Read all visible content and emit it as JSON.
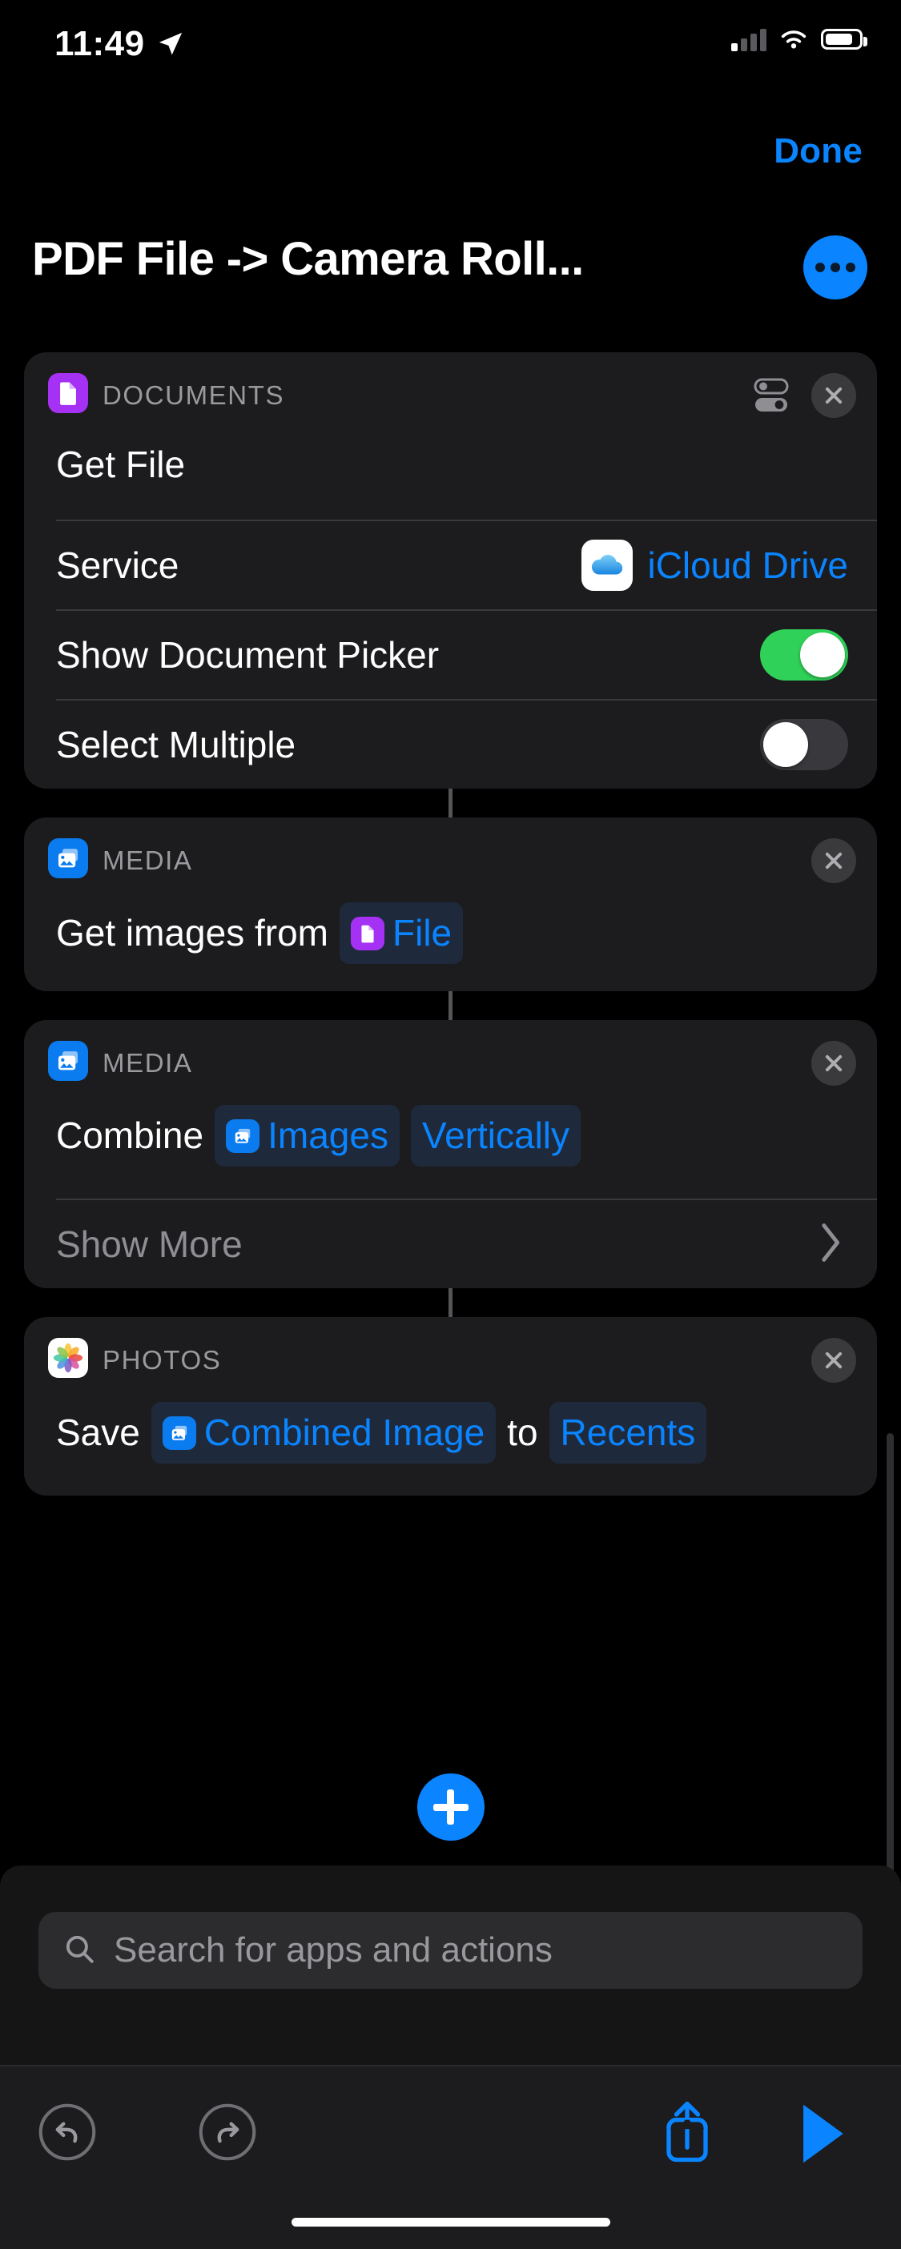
{
  "status_bar": {
    "time": "11:49",
    "location_icon": "location-arrow-icon",
    "cellular_icon": "cellular-signal-icon",
    "cellular_bars_filled": 1,
    "wifi_icon": "wifi-icon",
    "battery_icon": "battery-icon",
    "battery_level_pct": 72
  },
  "nav": {
    "done_label": "Done",
    "title": "PDF File -> Camera Roll...",
    "more_button_icon": "ellipsis-icon"
  },
  "colors": {
    "accent_blue": "#0a84ff",
    "toggle_on_green": "#30d158",
    "documents_purple": "#a531f5",
    "media_blue": "#0a7cf0",
    "card_bg": "#1c1c1e",
    "token_bg": "#1e2a3c",
    "screen_bg": "#000000"
  },
  "actions": [
    {
      "category": "DOCUMENTS",
      "app_icon": "document-icon",
      "has_settings_icon": true,
      "settings_icon": "sliders-icon",
      "close_icon": "close-circle-icon",
      "title": "Get File",
      "parameters": [
        {
          "type": "value",
          "label": "Service",
          "value": "iCloud Drive",
          "value_icon": "icloud-drive-icon"
        },
        {
          "type": "toggle",
          "label": "Show Document Picker",
          "state": "on"
        },
        {
          "type": "toggle",
          "label": "Select Multiple",
          "state": "off"
        }
      ]
    },
    {
      "category": "MEDIA",
      "app_icon": "photos-stack-icon",
      "has_settings_icon": false,
      "close_icon": "close-circle-icon",
      "line": [
        {
          "kind": "text",
          "text": "Get images from"
        },
        {
          "kind": "token",
          "text": "File",
          "icon": "document-icon",
          "icon_color": "purple"
        }
      ]
    },
    {
      "category": "MEDIA",
      "app_icon": "photos-stack-icon",
      "has_settings_icon": false,
      "close_icon": "close-circle-icon",
      "line": [
        {
          "kind": "text",
          "text": "Combine"
        },
        {
          "kind": "token",
          "text": "Images",
          "icon": "photos-stack-icon",
          "icon_color": "blue"
        },
        {
          "kind": "token",
          "text": "Vertically",
          "icon": null
        }
      ],
      "show_more_label": "Show More",
      "show_more_icon": "chevron-right-icon"
    },
    {
      "category": "PHOTOS",
      "app_icon": "photos-app-icon",
      "has_settings_icon": false,
      "close_icon": "close-circle-icon",
      "line": [
        {
          "kind": "text",
          "text": "Save"
        },
        {
          "kind": "token",
          "text": "Combined Image",
          "icon": "photos-stack-icon",
          "icon_color": "blue"
        },
        {
          "kind": "text",
          "text": "to"
        },
        {
          "kind": "token",
          "text": "Recents",
          "icon": null
        }
      ]
    }
  ],
  "add_action": {
    "icon": "plus-icon",
    "label": ""
  },
  "search": {
    "placeholder": "Search for apps and actions",
    "value": "",
    "icon": "search-icon"
  },
  "toolbar": {
    "undo_icon": "undo-icon",
    "redo_icon": "redo-icon",
    "share_icon": "share-icon",
    "run_icon": "play-icon"
  }
}
